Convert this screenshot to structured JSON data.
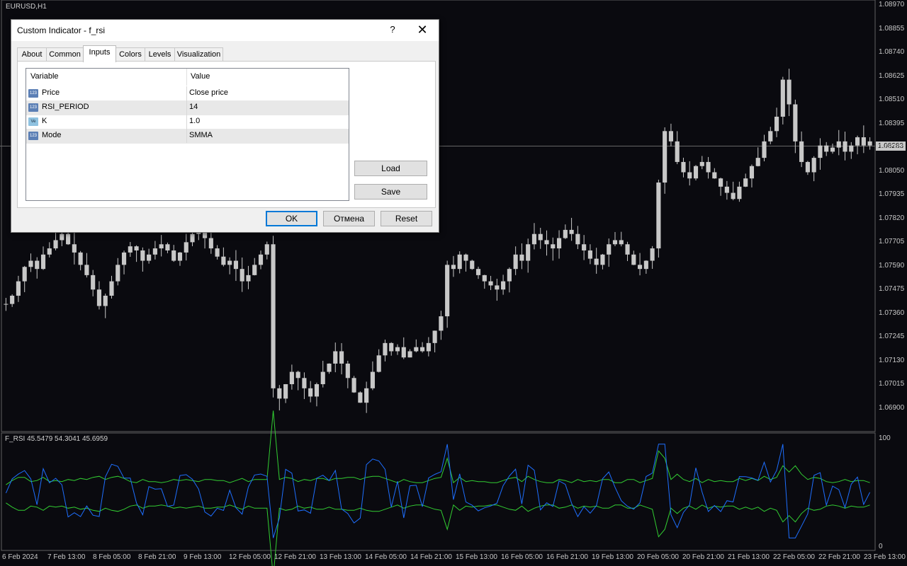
{
  "chart": {
    "symbol_label": "EURUSD,H1",
    "indicator_label": "F_RSI 45.5479 54.3041 45.6959",
    "current_price": "1.08283",
    "price_axis": [
      "1.08970",
      "1.08855",
      "1.08740",
      "1.08625",
      "1.08510",
      "1.08395",
      "1.08165",
      "1.08050",
      "1.07935",
      "1.07820",
      "1.07705",
      "1.07590",
      "1.07475",
      "1.07360",
      "1.07245",
      "1.07130",
      "1.07015",
      "1.06900"
    ],
    "indicator_axis": [
      "100",
      "0"
    ],
    "time_axis": [
      "6 Feb 2024",
      "7 Feb 13:00",
      "8 Feb 05:00",
      "8 Feb 21:00",
      "9 Feb 13:00",
      "12 Feb 05:00",
      "12 Feb 21:00",
      "13 Feb 13:00",
      "14 Feb 05:00",
      "14 Feb 21:00",
      "15 Feb 13:00",
      "16 Feb 05:00",
      "16 Feb 21:00",
      "19 Feb 13:00",
      "20 Feb 05:00",
      "20 Feb 21:00",
      "21 Feb 13:00",
      "22 Feb 05:00",
      "22 Feb 21:00",
      "23 Feb 13:00"
    ],
    "colors": {
      "background": "#0a0a0f",
      "candles": "#c8c8c8",
      "rsi_line": "#1e6fff",
      "band_lines": "#32cd32"
    },
    "price_close_series": [
      1.0751,
      1.0755,
      1.0762,
      1.0769,
      1.0772,
      1.0768,
      1.0775,
      1.0778,
      1.0782,
      1.0785,
      1.078,
      1.0776,
      1.077,
      1.0765,
      1.0758,
      1.075,
      1.0755,
      1.0762,
      1.077,
      1.0776,
      1.0779,
      1.0777,
      1.0772,
      1.0775,
      1.0778,
      1.078,
      1.0777,
      1.0772,
      1.0776,
      1.0781,
      1.0785,
      1.0788,
      1.0783,
      1.0778,
      1.0774,
      1.077,
      1.0772,
      1.0768,
      1.0762,
      1.0765,
      1.077,
      1.0775,
      1.078,
      1.071,
      1.0705,
      1.0712,
      1.0718,
      1.0715,
      1.071,
      1.0706,
      1.0712,
      1.0718,
      1.0722,
      1.0728,
      1.0722,
      1.0715,
      1.0708,
      1.0703,
      1.071,
      1.0718,
      1.0726,
      1.0732,
      1.0728,
      1.073,
      1.0725,
      1.0728,
      1.073,
      1.0728,
      1.0732,
      1.0738,
      1.0745,
      1.077,
      1.0768,
      1.0775,
      1.0772,
      1.0768,
      1.0765,
      1.0762,
      1.076,
      1.0758,
      1.0762,
      1.0768,
      1.0775,
      1.0772,
      1.078,
      1.0785,
      1.0782,
      1.078,
      1.0778,
      1.0783,
      1.0787,
      1.0785,
      1.078,
      1.0777,
      1.0773,
      1.077,
      1.0775,
      1.078,
      1.0782,
      1.078,
      1.0775,
      1.077,
      1.0768,
      1.0772,
      1.0778,
      1.081,
      1.0835,
      1.083,
      1.082,
      1.0815,
      1.0812,
      1.0818,
      1.082,
      1.0815,
      1.0812,
      1.0808,
      1.0805,
      1.0802,
      1.0808,
      1.0812,
      1.0818,
      1.0822,
      1.083,
      1.0835,
      1.0842,
      1.086,
      1.0848,
      1.083,
      1.082,
      1.0815,
      1.0822,
      1.0828,
      1.0825,
      1.0827,
      1.083,
      1.0825,
      1.0828,
      1.0832,
      1.0828,
      1.083
    ]
  },
  "dialog": {
    "title": "Custom Indicator - f_rsi",
    "help": "?",
    "close": "✕",
    "tabs": [
      "About",
      "Common",
      "Inputs",
      "Colors",
      "Levels",
      "Visualization"
    ],
    "grid": {
      "headers": [
        "Variable",
        "Value"
      ],
      "rows": [
        {
          "icon": "123",
          "variable": "Price",
          "value": "Close price"
        },
        {
          "icon": "123",
          "variable": "RSI_PERIOD",
          "value": "14"
        },
        {
          "icon": "Ve",
          "variable": "K",
          "value": "1.0"
        },
        {
          "icon": "123",
          "variable": "Mode",
          "value": "SMMA"
        }
      ]
    },
    "buttons": {
      "load": "Load",
      "save": "Save",
      "ok": "OK",
      "cancel": "Отмена",
      "reset": "Reset"
    }
  }
}
